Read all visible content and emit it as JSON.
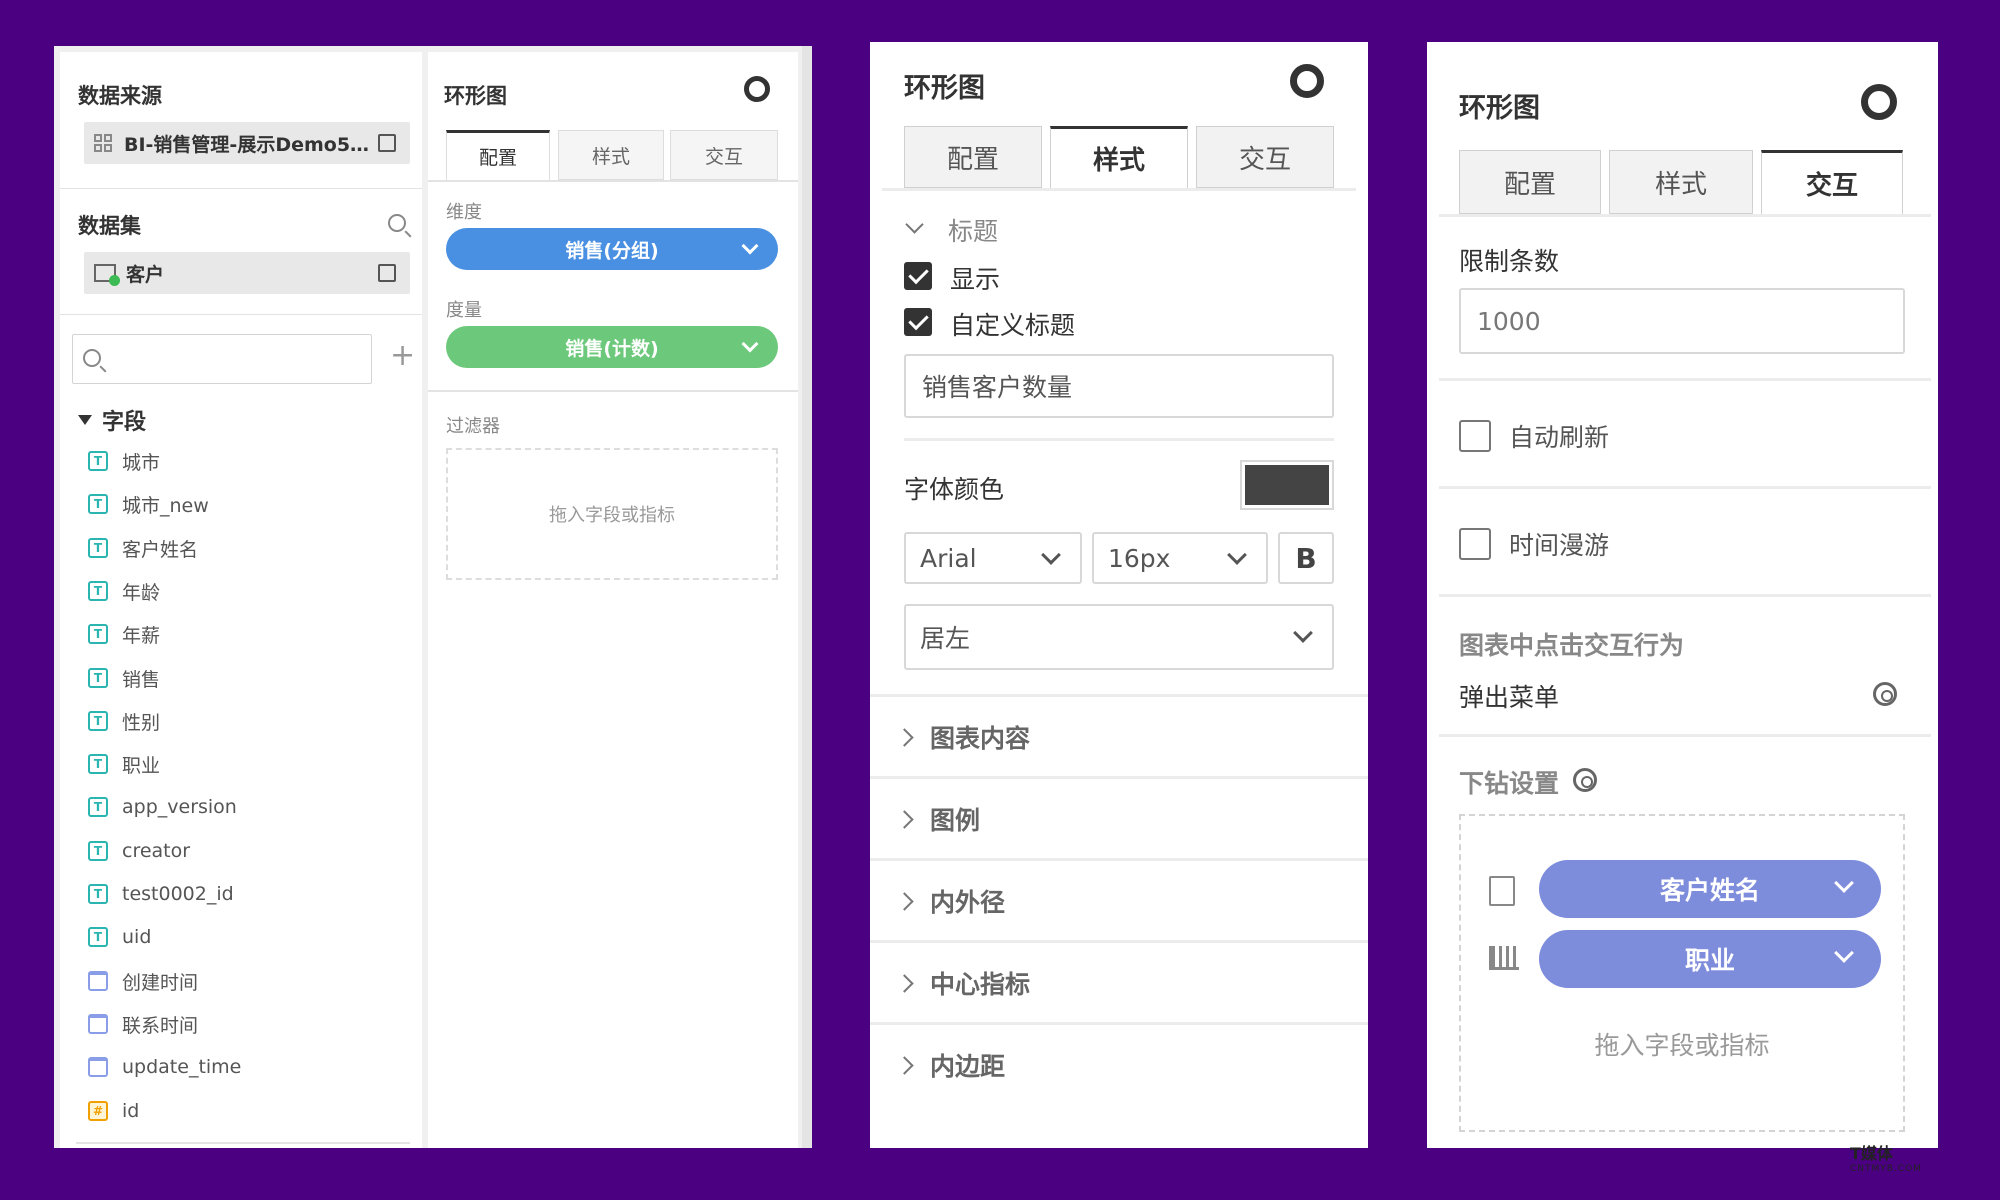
{
  "panel1": {
    "datasource_title": "数据来源",
    "datasource_value": "BI-销售管理-展示Demo5…",
    "dataset_title": "数据集",
    "dataset_value": "客户",
    "fields_title": "字段",
    "fields": [
      {
        "type": "text",
        "label": "城市"
      },
      {
        "type": "text",
        "label": "城市_new"
      },
      {
        "type": "text",
        "label": "客户姓名"
      },
      {
        "type": "text",
        "label": "年龄"
      },
      {
        "type": "text",
        "label": "年薪"
      },
      {
        "type": "text",
        "label": "销售"
      },
      {
        "type": "text",
        "label": "性别"
      },
      {
        "type": "text",
        "label": "职业"
      },
      {
        "type": "text",
        "label": "app_version"
      },
      {
        "type": "text",
        "label": "creator"
      },
      {
        "type": "text",
        "label": "test0002_id"
      },
      {
        "type": "text",
        "label": "uid"
      },
      {
        "type": "date",
        "label": "创建时间"
      },
      {
        "type": "date",
        "label": "联系时间"
      },
      {
        "type": "date",
        "label": "update_time"
      },
      {
        "type": "number",
        "label": "id"
      }
    ],
    "chart_title": "环形图",
    "tabs": [
      "配置",
      "样式",
      "交互"
    ],
    "active_tab": "配置",
    "dimension_label": "维度",
    "dimension_value": "销售(分组)",
    "measure_label": "度量",
    "measure_value": "销售(计数)",
    "filter_label": "过滤器",
    "filter_placeholder": "拖入字段或指标",
    "colors": {
      "dimension": "#4a90e2",
      "measure": "#6cc87a"
    }
  },
  "panel2": {
    "chart_title": "环形图",
    "tabs": [
      "配置",
      "样式",
      "交互"
    ],
    "active_tab": "样式",
    "title_section": "标题",
    "show_label": "显示",
    "custom_title_label": "自定义标题",
    "custom_title_value": "销售客户数量",
    "font_color_label": "字体颜色",
    "font_color": "#444444",
    "font_family": "Arial",
    "font_size": "16px",
    "bold_label": "B",
    "align": "居左",
    "sections": [
      "图表内容",
      "图例",
      "内外径",
      "中心指标",
      "内边距"
    ]
  },
  "panel3": {
    "chart_title": "环形图",
    "tabs": [
      "配置",
      "样式",
      "交互"
    ],
    "active_tab": "交互",
    "limit_label": "限制条数",
    "limit_value": "1000",
    "auto_refresh_label": "自动刷新",
    "time_roam_label": "时间漫游",
    "click_behavior_label": "图表中点击交互行为",
    "click_behavior_value": "弹出菜单",
    "drill_label": "下钻设置",
    "drill_fields": [
      "客户姓名",
      "职业"
    ],
    "drill_placeholder": "拖入字段或指标",
    "pill_color": "#7e8cdc"
  },
  "watermark": {
    "name": "T媒体",
    "sub": "CNTMYB.COM"
  }
}
